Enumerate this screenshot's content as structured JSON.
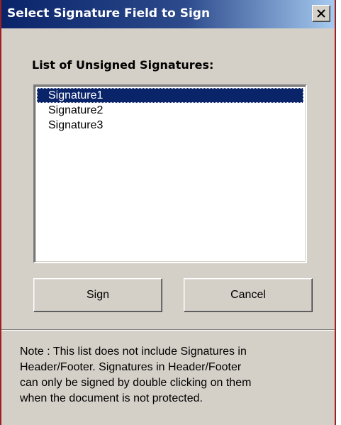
{
  "dialog": {
    "title": "Select Signature Field to Sign",
    "close_icon": "close-icon"
  },
  "list": {
    "label": "List of Unsigned Signatures:",
    "selected_index": 0,
    "items": [
      {
        "label": "Signature1"
      },
      {
        "label": "Signature2"
      },
      {
        "label": "Signature3"
      }
    ]
  },
  "buttons": {
    "sign_label": "Sign",
    "cancel_label": "Cancel"
  },
  "note": {
    "lines": [
      "Note :  This list does not include Signatures in",
      "Header/Footer. Signatures in Header/Footer",
      "can only be signed by double clicking on them",
      "when the document is not protected."
    ]
  },
  "colors": {
    "titlebar_start": "#0a246a",
    "titlebar_end": "#a6caf0",
    "dialog_face": "#d4d0c8",
    "selection": "#0a246a",
    "frame_border": "#a02020"
  }
}
